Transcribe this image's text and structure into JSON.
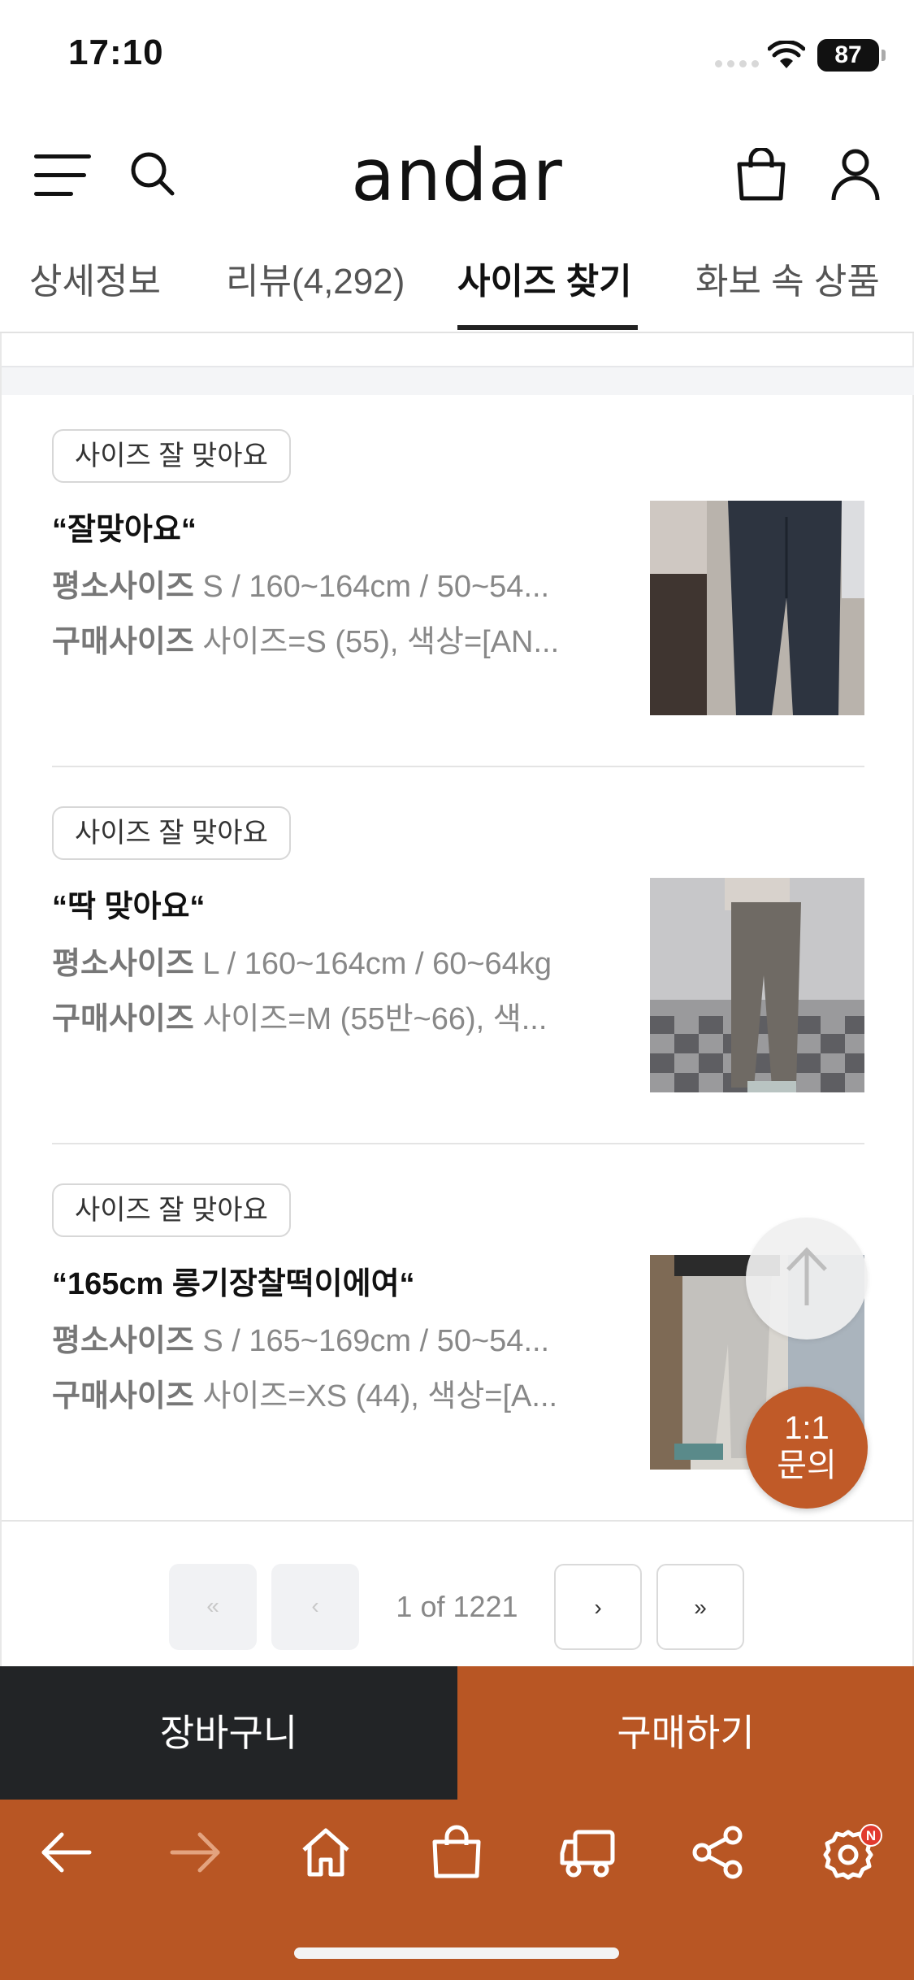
{
  "status_bar": {
    "time": "17:10",
    "battery": "87"
  },
  "header": {
    "logo": "andar"
  },
  "tabs": [
    {
      "label": "상세정보",
      "active": false
    },
    {
      "label": "리뷰(4,292)",
      "active": false
    },
    {
      "label": "사이즈 찾기",
      "active": true
    },
    {
      "label": "화보 속 상품",
      "active": false
    }
  ],
  "reviews": [
    {
      "badge": "사이즈 잘 맞아요",
      "title": "“잘맞아요“",
      "usual_size_label": "평소사이즈",
      "usual_size": "S / 160~164cm / 50~54...",
      "purchased_size_label": "구매사이즈",
      "purchased_size": "사이즈=S (55), 색상=[AN..."
    },
    {
      "badge": "사이즈 잘 맞아요",
      "title": "“딱 맞아요“",
      "usual_size_label": "평소사이즈",
      "usual_size": "L / 160~164cm / 60~64kg",
      "purchased_size_label": "구매사이즈",
      "purchased_size": "사이즈=M (55반~66), 색..."
    },
    {
      "badge": "사이즈 잘 맞아요",
      "title": "“165cm 롱기장찰떡이에여“",
      "usual_size_label": "평소사이즈",
      "usual_size": "S / 165~169cm / 50~54...",
      "purchased_size_label": "구매사이즈",
      "purchased_size": "사이즈=XS (44), 색상=[A..."
    }
  ],
  "floating": {
    "inquiry_line1": "1:1",
    "inquiry_line2": "문의"
  },
  "pagination": {
    "first": "«",
    "prev": "‹",
    "info": "1 of 1221",
    "next": "›",
    "last": "»"
  },
  "actions": {
    "cart": "장바구니",
    "buy": "구매하기"
  },
  "toolbar": {
    "settings_badge": "N"
  },
  "colors": {
    "accent": "#b85624",
    "dark": "#222426"
  }
}
